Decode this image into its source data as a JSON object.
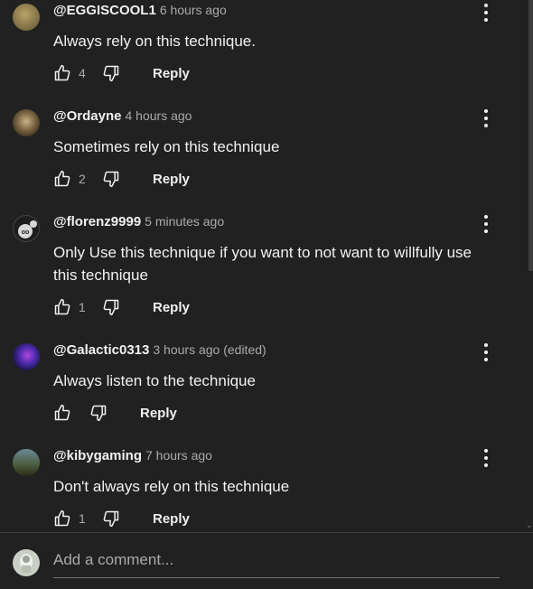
{
  "comments": [
    {
      "handle": "@EGGISCOOL1",
      "time": "6 hours ago",
      "text": "Always rely on this technique.",
      "likes": "4",
      "reply_label": "Reply",
      "avatar_color": "#8a7a52"
    },
    {
      "handle": "@Ordayne",
      "time": "4 hours ago",
      "text": "Sometimes rely on this technique",
      "likes": "2",
      "reply_label": "Reply",
      "avatar_color": "#6b5a3a"
    },
    {
      "handle": "@florenz9999",
      "time": "5 minutes ago",
      "text": "Only Use this technique if you want to not want to willfully use this technique",
      "likes": "1",
      "reply_label": "Reply",
      "avatar_color": "#2a2a2a"
    },
    {
      "handle": "@Galactic0313",
      "time": "3 hours ago (edited)",
      "text": "Always listen to the technique",
      "likes": "",
      "reply_label": "Reply",
      "avatar_color": "#3b2a8c"
    },
    {
      "handle": "@kibygaming",
      "time": "7 hours ago",
      "text": "Don't always rely on this technique",
      "likes": "1",
      "reply_label": "Reply",
      "avatar_color": "#5a6a4a"
    }
  ],
  "add_comment": {
    "placeholder": "Add a comment..."
  },
  "colors": {
    "background": "#212121",
    "text": "#f1f1f1",
    "secondary": "#aaaaaa"
  }
}
